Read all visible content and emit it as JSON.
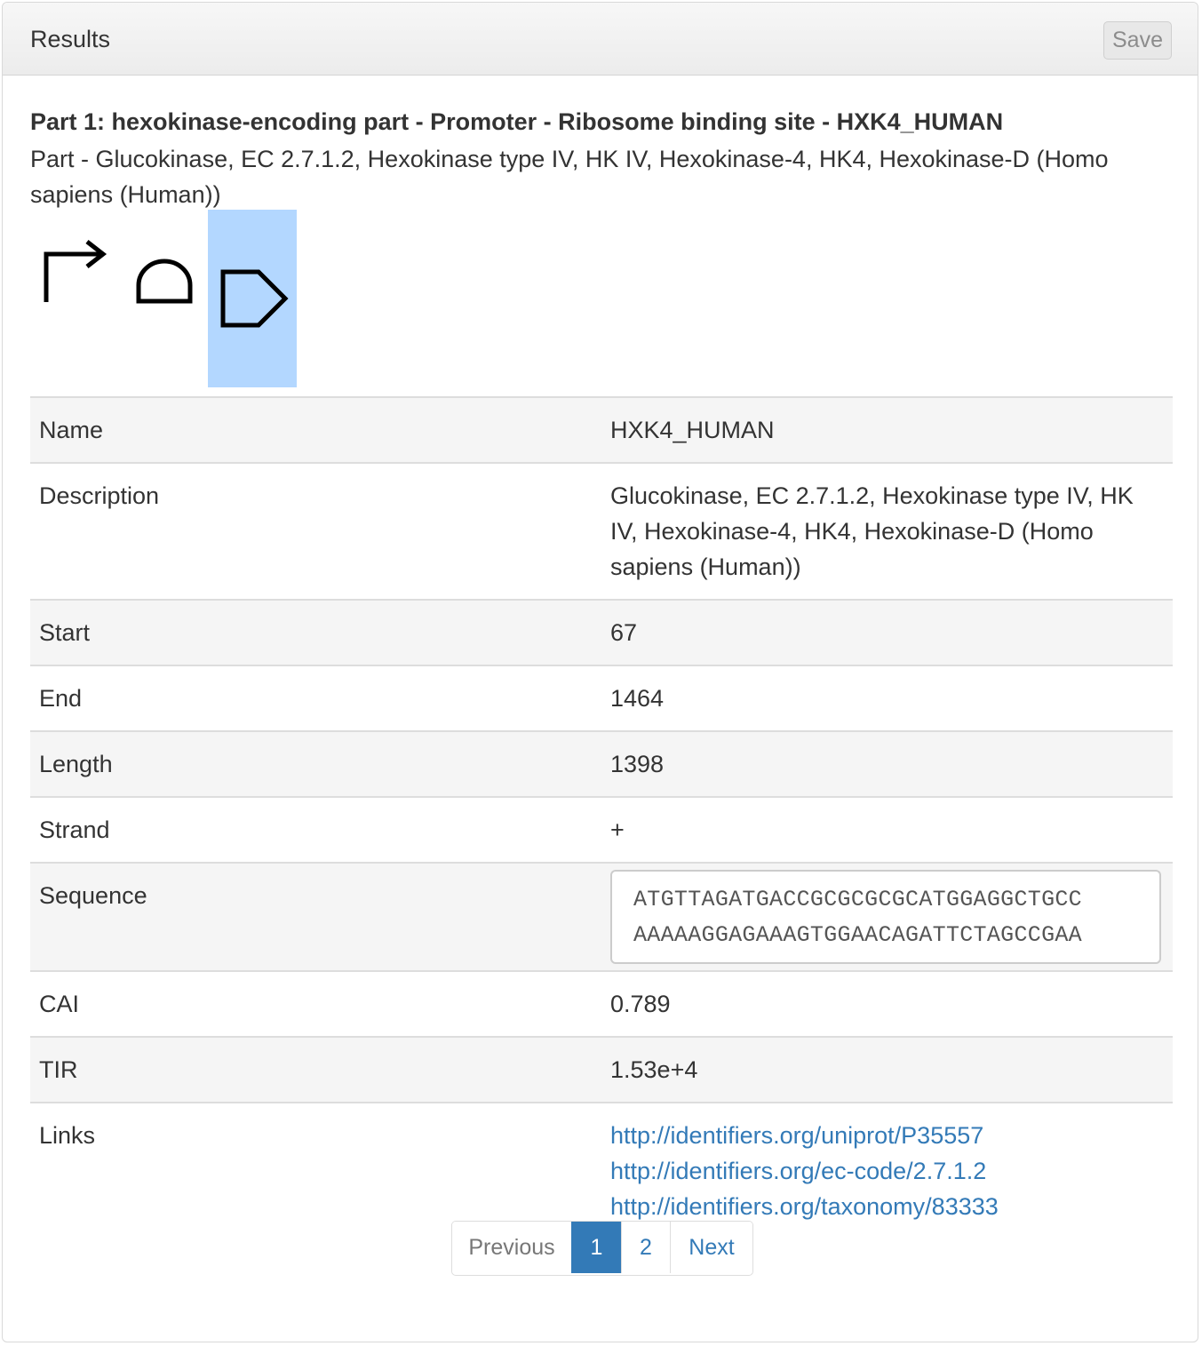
{
  "panel": {
    "title": "Results",
    "save_label": "Save"
  },
  "part": {
    "title": "Part 1: hexokinase-encoding part - Promoter - Ribosome binding site - HXK4_HUMAN",
    "subtitle": "Part - Glucokinase, EC 2.7.1.2, Hexokinase type IV, HK IV, Hexokinase-4, HK4, Hexokinase-D (Homo sapiens (Human))"
  },
  "glyphs": [
    {
      "icon": "promoter-icon"
    },
    {
      "icon": "ribosome-binding-site-icon"
    },
    {
      "icon": "cds-icon",
      "selected": true,
      "highlight_color": "#b3d7ff"
    }
  ],
  "table": {
    "name_label": "Name",
    "name_value": "HXK4_HUMAN",
    "description_label": "Description",
    "description_value": "Glucokinase, EC 2.7.1.2, Hexokinase type IV, HK IV, Hexokinase-4, HK4, Hexokinase-D (Homo sapiens (Human))",
    "start_label": "Start",
    "start_value": "67",
    "end_label": "End",
    "end_value": "1464",
    "length_label": "Length",
    "length_value": "1398",
    "strand_label": "Strand",
    "strand_value": "+",
    "sequence_label": "Sequence",
    "sequence_line1": "ATGTTAGATGACCGCGCGCGCATGGAGGCTGCC",
    "sequence_line2": "AAAAAGGAGAAAGTGGAACAGATTCTAGCCGAA",
    "cai_label": "CAI",
    "cai_value": "0.789",
    "tir_label": "TIR",
    "tir_value": "1.53e+4",
    "links_label": "Links",
    "links": [
      "http://identifiers.org/uniprot/P35557",
      "http://identifiers.org/ec-code/2.7.1.2",
      "http://identifiers.org/taxonomy/83333"
    ]
  },
  "pagination": {
    "previous": "Previous",
    "pages": [
      "1",
      "2"
    ],
    "current": "1",
    "next": "Next"
  },
  "colors": {
    "link": "#337ab7",
    "active_page": "#337ab7",
    "selection": "#b3d7ff"
  }
}
